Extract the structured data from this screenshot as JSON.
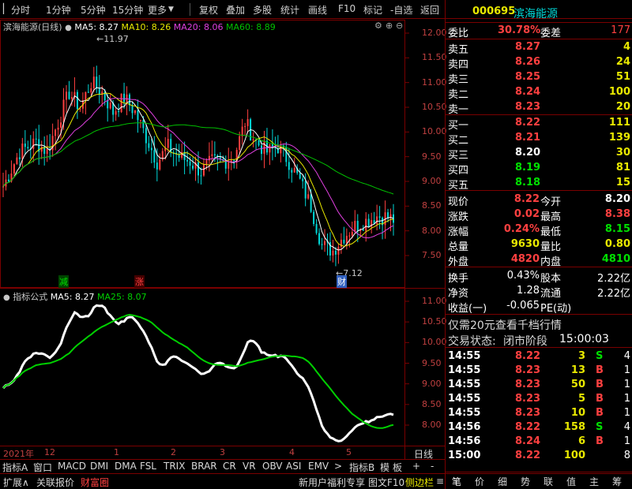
{
  "toolbar": {
    "items": [
      "分时",
      "1分钟",
      "5分钟",
      "15分钟",
      "更多",
      "复权",
      "叠加",
      "多股",
      "统计",
      "画线",
      "F10",
      "标记",
      "-自选",
      "返回"
    ]
  },
  "chart": {
    "stock_title": "滨海能源(日线)",
    "ma5": "MA5: 8.27",
    "ma10": "MA10: 8.26",
    "ma20": "MA20: 8.06",
    "ma60": "MA60: 8.89",
    "high_label": "11.97",
    "low_label": "7.12",
    "y_ticks": [
      "12.00",
      "11.50",
      "11.00",
      "10.50",
      "10.00",
      "9.50",
      "9.00",
      "8.50",
      "8.00",
      "7.50"
    ],
    "marker_jian": "减",
    "marker_zhang": "涨",
    "marker_cai": "财"
  },
  "indicator": {
    "title": "指标公式",
    "ma5": "MA5: 8.27",
    "ma25": "MA25: 8.07",
    "y_ticks": [
      "11.00",
      "10.50",
      "10.00",
      "9.50",
      "9.00",
      "8.50",
      "8.00"
    ]
  },
  "x_axis": {
    "ticks": [
      "2021年",
      "12",
      "1",
      "2",
      "3",
      "4",
      "5"
    ],
    "period": "日线"
  },
  "tabs": [
    "指标A",
    "窗口",
    "MACD",
    "DMI",
    "DMA",
    "FSL",
    "TRIX",
    "BRAR",
    "CR",
    "VR",
    "OBV",
    "ASI",
    "EMV",
    ">",
    "指标B",
    "模",
    "板",
    "+",
    "-"
  ],
  "status": {
    "left": [
      "扩展∧",
      "关联报价",
      "财富圈"
    ],
    "promo": "新用户福利专享",
    "right": [
      "图文F10",
      "侧边栏",
      "≡"
    ]
  },
  "panel": {
    "code": "000695",
    "name": "滨海能源",
    "weibi_label": "委比",
    "weibi": "30.78%",
    "weicha_label": "委差",
    "weicha": "177",
    "sell": [
      {
        "label": "卖五",
        "price": "8.27",
        "vol": "4"
      },
      {
        "label": "卖四",
        "price": "8.26",
        "vol": "24"
      },
      {
        "label": "卖三",
        "price": "8.25",
        "vol": "51"
      },
      {
        "label": "卖二",
        "price": "8.24",
        "vol": "100"
      },
      {
        "label": "卖一",
        "price": "8.23",
        "vol": "20"
      }
    ],
    "buy": [
      {
        "label": "买一",
        "price": "8.22",
        "vol": "111"
      },
      {
        "label": "买二",
        "price": "8.21",
        "vol": "139"
      },
      {
        "label": "买三",
        "price": "8.20",
        "vol": "30"
      },
      {
        "label": "买四",
        "price": "8.19",
        "vol": "81"
      },
      {
        "label": "买五",
        "price": "8.18",
        "vol": "15"
      }
    ],
    "quote": [
      {
        "l1": "现价",
        "v1": "8.22",
        "l2": "今开",
        "v2": "8.20"
      },
      {
        "l1": "涨跌",
        "v1": "0.02",
        "l2": "最高",
        "v2": "8.38"
      },
      {
        "l1": "涨幅",
        "v1": "0.24%",
        "l2": "最低",
        "v2": "8.15"
      },
      {
        "l1": "总量",
        "v1": "9630",
        "l2": "量比",
        "v2": "0.80"
      },
      {
        "l1": "外盘",
        "v1": "4820",
        "l2": "内盘",
        "v2": "4810"
      }
    ],
    "stats": [
      {
        "l1": "换手",
        "v1": "0.43%",
        "l2": "股本",
        "v2": "2.22亿"
      },
      {
        "l1": "净资",
        "v1": "1.28",
        "l2": "流通",
        "v2": "2.22亿"
      },
      {
        "l1": "收益(一)",
        "v1": "-0.065",
        "l2": "PE(动)",
        "v2": ""
      }
    ],
    "promo": "仅需20元查看千档行情",
    "trade_status_label": "交易状态:",
    "trade_status": "闭市阶段",
    "trade_time": "15:00:03",
    "ticks": [
      {
        "t": "14:55",
        "p": "8.22",
        "v": "3",
        "s": "S",
        "n": "4"
      },
      {
        "t": "14:55",
        "p": "8.23",
        "v": "13",
        "s": "B",
        "n": "1"
      },
      {
        "t": "14:55",
        "p": "8.23",
        "v": "50",
        "s": "B",
        "n": "1"
      },
      {
        "t": "14:55",
        "p": "8.23",
        "v": "5",
        "s": "B",
        "n": "1"
      },
      {
        "t": "14:55",
        "p": "8.23",
        "v": "10",
        "s": "B",
        "n": "1"
      },
      {
        "t": "14:56",
        "p": "8.22",
        "v": "158",
        "s": "S",
        "n": "4"
      },
      {
        "t": "14:56",
        "p": "8.24",
        "v": "6",
        "s": "B",
        "n": "1"
      },
      {
        "t": "15:00",
        "p": "8.22",
        "v": "100",
        "s": "",
        "n": "8"
      }
    ],
    "bottom_tabs": [
      "笔",
      "价",
      "细",
      "势",
      "联",
      "值",
      "主",
      "筹"
    ]
  },
  "colors": {
    "up": "#ff4040",
    "down": "#00e000",
    "ma5": "#ffffff",
    "ma10": "#e8e800",
    "ma20": "#e040e0",
    "ma60": "#00c000",
    "border": "#7a0000"
  }
}
